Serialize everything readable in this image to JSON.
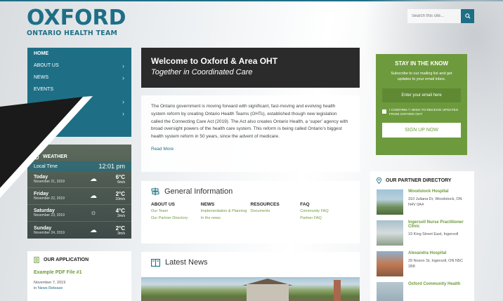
{
  "brand": {
    "logo_main": "OXFORD",
    "logo_sub": "ONTARIO HEALTH TEAM",
    "accent": "#1e6f86",
    "green": "#6e9a3e"
  },
  "search": {
    "placeholder": "Search this site...",
    "icon": "search-icon"
  },
  "nav": {
    "items": [
      {
        "label": "HOME",
        "has_sub": false
      },
      {
        "label": "ABOUT US",
        "has_sub": true
      },
      {
        "label": "NEWS",
        "has_sub": true
      },
      {
        "label": "EVENTS",
        "has_sub": false
      },
      {
        "label": "",
        "has_sub": true
      },
      {
        "label": "",
        "has_sub": true
      }
    ]
  },
  "weather": {
    "title": "WEATHER",
    "local_label": "Local Time",
    "local_time": "12:01 pm",
    "days": [
      {
        "day": "Today",
        "date": "November 21, 2019",
        "icon": "cloud-icon",
        "temp": "6°C",
        "wind": "6m/s"
      },
      {
        "day": "Friday",
        "date": "November 22, 2019",
        "icon": "cloud-icon",
        "temp": "2°C",
        "wind": "10m/s"
      },
      {
        "day": "Saturday",
        "date": "November 23, 2019",
        "icon": "sun-icon",
        "temp": "4°C",
        "wind": "2m/s"
      },
      {
        "day": "Sunday",
        "date": "November 24, 2019",
        "icon": "cloud-icon",
        "temp": "2°C",
        "wind": "3m/s"
      }
    ]
  },
  "application": {
    "title": "OUR APPLICATION",
    "link": "Example PDF File #1",
    "date": "November 7, 2019",
    "in_label": "in",
    "category": "News Release"
  },
  "welcome": {
    "title": "Welcome to Oxford & Area OHT",
    "subtitle": "Together in Coordinated Care"
  },
  "intro": {
    "text": "The Ontario government is moving forward with significant, fast-moving and evolving health system reform by creating Ontario Health Teams (OHTs), established though new legislation called the Connecting Care Act (2019). The Act also creates Ontario Health, a ‘super’ agency with broad oversight powers of the health care system. This reform is being called Ontario’s biggest health system reform in 50 years, since the advent of medicare.",
    "read_more": "Read More"
  },
  "general_info": {
    "title": "General Information",
    "columns": [
      {
        "heading": "ABOUT US",
        "links": [
          "Our Team",
          "Our Partner Directory"
        ]
      },
      {
        "heading": "NEWS",
        "links": [
          "Implementation & Planning",
          "In the news"
        ]
      },
      {
        "heading": "RESOURCES",
        "links": [
          "Documents"
        ]
      },
      {
        "heading": "FAQ",
        "links": [
          "Community FAQ",
          "Partner FAQ"
        ]
      }
    ]
  },
  "latest_news": {
    "title": "Latest News"
  },
  "stay": {
    "title": "STAY IN THE KNOW",
    "desc": "Subscribe to our mailing list and get updates to your email inbox.",
    "email_placeholder": "Enter your email here",
    "consent": "I CONFIRM / I WISH TO RECEIVE UPDATES FROM OXFORD OHT",
    "button": "SIGN UP NOW"
  },
  "partners": {
    "title": "OUR PARTNER DIRECTORY",
    "items": [
      {
        "name": "Woodstock Hospital",
        "address": "310 Juliana Dr, Woodstock, ON N4V 0A4"
      },
      {
        "name": "Ingersoll Nurse Practitioner Clinic",
        "address": "19 King Street East, Ingersoll"
      },
      {
        "name": "Alexandra Hospital",
        "address": "29 Noxon St, Ingersoll, ON N5C 1B8"
      },
      {
        "name": "Oxford Community Health",
        "address": ""
      }
    ]
  }
}
